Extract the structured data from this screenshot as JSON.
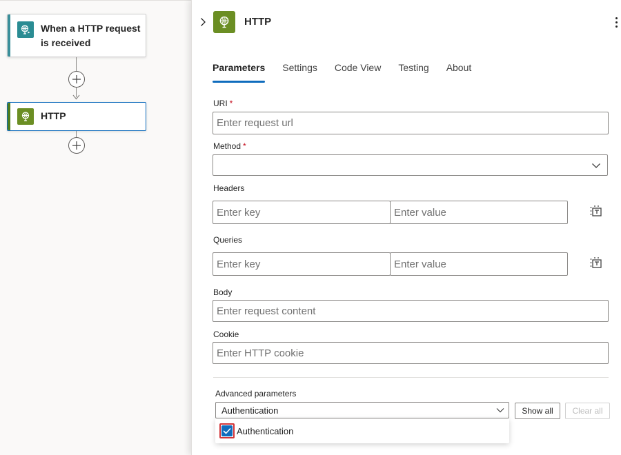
{
  "canvas": {
    "trigger": {
      "title": "When a HTTP request is received",
      "icon": "http-request-globe-icon"
    },
    "action": {
      "title": "HTTP",
      "icon": "http-globe-icon"
    }
  },
  "panel": {
    "title": "HTTP",
    "icon": "http-globe-icon",
    "tabs": [
      {
        "label": "Parameters",
        "active": true
      },
      {
        "label": "Settings"
      },
      {
        "label": "Code View"
      },
      {
        "label": "Testing"
      },
      {
        "label": "About"
      }
    ],
    "uri": {
      "label": "URI",
      "required": "*",
      "placeholder": "Enter request url"
    },
    "method": {
      "label": "Method",
      "required": "*",
      "value": ""
    },
    "headers": {
      "label": "Headers",
      "key_placeholder": "Enter key",
      "value_placeholder": "Enter value"
    },
    "queries": {
      "label": "Queries",
      "key_placeholder": "Enter key",
      "value_placeholder": "Enter value"
    },
    "body": {
      "label": "Body",
      "placeholder": "Enter request content"
    },
    "cookie": {
      "label": "Cookie",
      "placeholder": "Enter HTTP cookie"
    },
    "advanced": {
      "label": "Advanced parameters",
      "selected": "Authentication",
      "show_all": "Show all",
      "clear_all": "Clear all",
      "options": [
        {
          "label": "Authentication",
          "checked": true
        }
      ]
    }
  },
  "colors": {
    "accent": "#0f6cbd",
    "http_green": "#6b8e23",
    "trigger_teal": "#2a8c93",
    "required": "#c50f1f",
    "highlight_border": "#d13438"
  }
}
